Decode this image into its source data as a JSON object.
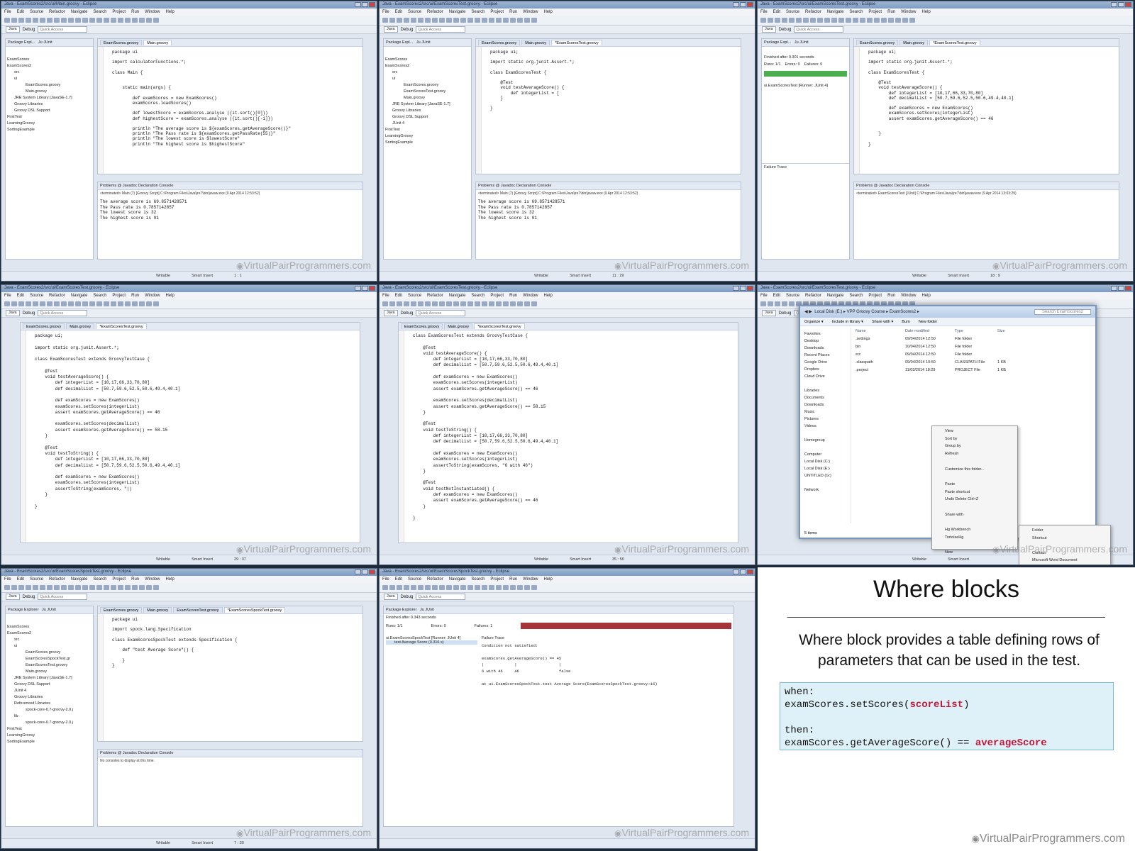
{
  "menu": [
    "File",
    "Edit",
    "Source",
    "Refactor",
    "Navigate",
    "Search",
    "Project",
    "Run",
    "Window",
    "Help"
  ],
  "perspectives": {
    "java": "Java",
    "debug": "Debug",
    "quick_access": "Quick Access"
  },
  "status": {
    "writable": "Writable",
    "insert": "Smart Insert"
  },
  "watermark": "VirtualPairProgrammers.com",
  "panels": [
    {
      "title": "Java - ExamScores2/src/ui/Main.groovy - Eclipse",
      "explorer_title": "Package Expl...",
      "explorer_title2": "Ju JUnit",
      "tree": [
        "ExamScores",
        "ExamScores2",
        "src",
        "ui",
        "ExamScores.groovy",
        "Main.groovy",
        "JRE System Library [JavaSE-1.7]",
        "Groovy Libraries",
        "Groovy DSL Support",
        "FirstTest",
        "LearningGroovy",
        "SortingExample"
      ],
      "tabs": [
        "ExamScores.groovy",
        "Main.groovy"
      ],
      "code": "package ui\n\nimport calculatorFunctions.*;\n\nclass Main {\n\n\n    static main(args) {\n\n        def examScores = new ExamScores()\n        examScores.loadScores()\n\n        def lowestScore = examScores.analyse ({it.sort()[0]})\n        def highestScore = examScores.analyse ({it.sort()[-1]})\n\n        println \"The average score is ${examScores.getAverageScore()}\"\n        println \"The Pass rate is ${examScores.getPassRate(55)}\"\n        println \"The lowest score is $lowestScore\"\n        println \"The highest score is $highestScore\"",
      "console_tabs": "Problems  @ Javadoc  Declaration  Console",
      "terminated": "<terminated> Main (7) [Groovy Script] C:\\Program Files\\Java\\jre7\\bin\\javaw.exe (9 Apr 2014 12:53:52)",
      "console": "The average score is 69.8571428571\nThe Pass rate is 0.7857142857\nThe lowest score is 32\nThe highest score is 91",
      "position": "1 : 1"
    },
    {
      "title": "Java - ExamScores2/src/ui/ExamScoresTest.groovy - Eclipse",
      "explorer_title": "Package Expl...",
      "explorer_title2": "Ju JUnit",
      "tree": [
        "ExamScores",
        "ExamScores2",
        "src",
        "ui",
        "ExamScores.groovy",
        "ExamScoresTest.groovy",
        "Main.groovy",
        "JRE System Library [JavaSE-1.7]",
        "Groovy Libraries",
        "Groovy DSL Support",
        "JUnit 4",
        "FirstTest",
        "LearningGroovy",
        "SortingExample"
      ],
      "tabs": [
        "ExamScores.groovy",
        "Main.groovy",
        "*ExamScoresTest.groovy"
      ],
      "code": "package ui;\n\nimport static org.junit.Assert.*;\n\nclass ExamScoresTest {\n\n    @Test\n    void testAverageScore() {\n        def integerList = [\n    }\n\n}",
      "console_tabs": "Problems  @ Javadoc  Declaration  Console",
      "terminated": "<terminated> Main (7) [Groovy Script] C:\\Program Files\\Java\\jre7\\bin\\javaw.exe (9 Apr 2014 12:53:52)",
      "console": "The average score is 69.8571428571\nThe Pass rate is 0.7857142857\nThe lowest score is 32\nThe highest score is 91",
      "position": "11 : 29"
    },
    {
      "title": "Java - ExamScores2/src/ui/ExamScoresTest.groovy - Eclipse",
      "explorer_title": "Package Expl...",
      "explorer_title2": "Ju JUnit",
      "finished": "Finished after 0.301 seconds",
      "runs": "Runs: 1/1",
      "errors": "Errors: 0",
      "failures": "Failures: 0",
      "junit_item": "ui.ExamScoresTest [Runner: JUnit 4]",
      "failure_trace": "Failure Trace",
      "tabs": [
        "ExamScores.groovy",
        "Main.groovy",
        "*ExamScoresTest.groovy"
      ],
      "code": "package ui;\n\nimport static org.junit.Assert.*;\n\nclass ExamScoresTest {\n\n    @Test\n    void testAverageScore() {\n        def integerList = [10,17,66,33,70,80]\n        def decimalList = [50.7,59.6,52.5,50.6,49.4,40.1]\n\n        def examScores = new ExamScores()\n        examScores.setScores(integerList)\n        assert examScores.getAverageScore() == 46\n\n\n    }\n\n}",
      "console_tabs": "Problems  @ Javadoc  Declaration  Console",
      "terminated": "<terminated> ExamScoresTest [JUnit] C:\\Program Files\\Java\\jre7\\bin\\javaw.exe (9 Apr 2014 13:03:29)",
      "console": "",
      "position": "18 : 9"
    },
    {
      "title": "Java - ExamScores2/src/ui/ExamScoresTest.groovy - Eclipse",
      "tabs": [
        "ExamScores.groovy",
        "Main.groovy",
        "*ExamScoresTest.groovy"
      ],
      "code": "package ui;\n\nimport static org.junit.Assert.*;\n\nclass ExamScoresTest extends GroovyTestCase {\n\n    @Test\n    void testAverageScore() {\n        def integerList = [10,17,66,33,70,80]\n        def decimalList = [50.7,59.6,52.5,50.6,49.4,40.1]\n\n        def examScores = new ExamScores()\n        examScores.setScores(integerList)\n        assert examScores.getAverageScore() == 46\n\n        examScores.setScores(decimalList)\n        assert examScores.getAverageScore() == 58.15\n    }\n\n    @Test\n    void testToString() {\n        def integerList = [10,17,66,33,70,80]\n        def decimalList = [50.7,59.6,52.5,50.6,49.4,40.1]\n\n        def examScores = new ExamScores()\n        examScores.setScores(integerList)\n        assertToString(examScores, \"|)\n    }\n\n}",
      "position": "29 : 37"
    },
    {
      "title": "Java - ExamScores2/src/ui/ExamScoresTest.groovy - Eclipse",
      "tabs": [
        "ExamScores.groovy",
        "Main.groovy",
        "*ExamScoresTest.groovy"
      ],
      "code": "class ExamScoresTest extends GroovyTestCase {\n\n    @Test\n    void testAverageScore() {\n        def integerList = [10,17,66,33,70,80]\n        def decimalList = [50.7,59.6,52.5,50.6,49.4,40.1]\n\n        def examScores = new ExamScores()\n        examScores.setScores(integerList)\n        assert examScores.getAverageScore() == 46\n\n        examScores.setScores(decimalList)\n        assert examScores.getAverageScore() == 58.15\n    }\n\n    @Test\n    void testToString() {\n        def integerList = [10,17,66,33,70,80]\n        def decimalList = [50.7,59.6,52.5,50.6,49.4,40.1]\n\n        def examScores = new ExamScores()\n        examScores.setScores(integerList)\n        assertToString(examScores, \"6 with 46\")\n    }\n\n    @Test\n    void testNotInstantiated() {\n        def examScores = new ExamScores()\n        assert examScores.getAverageScore() == 46\n    }\n\n}",
      "position": "35 : 50"
    },
    {
      "title": "Java - ExamScores2/src/ui/ExamScoresTest.groovy - Eclipse",
      "ex_path": "Local Disk (E:) ▸ VPP Groovy Course ▸ ExamScores2 ▸",
      "ex_search": "Search ExamScores2",
      "ex_toolbar": [
        "Organize ▾",
        "Include in library ▾",
        "Share with ▾",
        "Burn",
        "New folder"
      ],
      "ex_nav": [
        "Favorites",
        "Desktop",
        "Downloads",
        "Recent Places",
        "Google Drive",
        "Dropbox",
        "Cloud Drive",
        "",
        "Libraries",
        "Documents",
        "Downloads",
        "Music",
        "Pictures",
        "Videos",
        "",
        "Homegroup",
        "",
        "Computer",
        "Local Disk (C:)",
        "Local Disk (E:)",
        "UNTITLED (G:)",
        "",
        "Network"
      ],
      "ex_cols": [
        "Name",
        "Date modified",
        "Type",
        "Size"
      ],
      "ex_files": [
        [
          ".settings",
          "09/04/2014 12:50",
          "File folder",
          ""
        ],
        [
          "bin",
          "10/04/2014 12:50",
          "File folder",
          ""
        ],
        [
          "src",
          "09/04/2014 12:50",
          "File folder",
          ""
        ],
        [
          ".classpath",
          "09/04/2014 10:50",
          "CLASSPATH File",
          "1 KB"
        ],
        [
          ".project",
          "11/03/2014 18:29",
          "PROJECT File",
          "1 KB"
        ]
      ],
      "ex_items": "5 items",
      "ctx_menu": [
        "View",
        "Sort by",
        "Group by",
        "Refresh",
        "",
        "Customize this folder...",
        "",
        "Paste",
        "Paste shortcut",
        "Undo Delete    Ctrl+Z",
        "",
        "Share with",
        "",
        "Hg Workbench",
        "TortoiseHg",
        "",
        "New",
        "",
        "Properties"
      ],
      "sub_menu": [
        "Folder",
        "Shortcut",
        "",
        "Contact",
        "Microsoft Word Document",
        "Journal Document"
      ],
      "position": ""
    },
    {
      "title": "Java - ExamScores2/src/ui/ExamScoresSpockTest.groovy - Eclipse",
      "explorer_title": "Package Explorer",
      "explorer_title2": "Ju JUnit",
      "tree": [
        "ExamScores",
        "ExamScores2",
        "src",
        "ui",
        "ExamScores.groovy",
        "ExamScoresSpockTest.gr",
        "ExamScoresTest.groovy",
        "Main.groovy",
        "JRE System Library [JavaSE-1.7]",
        "Groovy DSL Support",
        "JUnit 4",
        "Groovy Libraries",
        "Referenced Libraries",
        "spock-core-0.7-groovy-2.0.j",
        "lib",
        "spock-core-0.7-groovy-2.0.j",
        "FirstTest",
        "LearningGroovy",
        "SortingExample"
      ],
      "tabs": [
        "ExamScores.groovy",
        "Main.groovy",
        "ExamScoresTest.groovy",
        "*ExamScoresSpockTest.groovy"
      ],
      "code": "package ui\n\nimport spock.lang.Specification\n\nclass ExamScoresSpockTest extends Specification {\n\n    def \"test Average Score\"() {\n\n    }\n}",
      "console_tabs": "Problems  @ Javadoc  Declaration  Console",
      "console": "No consoles to display at this time.",
      "position": "7 : 30"
    },
    {
      "title": "Java - ExamScores2/src/ui/ExamScoresSpockTest.groovy - Eclipse",
      "explorer_title": "Package Explorer",
      "explorer_title2": "Ju JUnit",
      "finished": "Finished after 0.343 seconds",
      "runs": "Runs: 1/1",
      "errors": "Errors: 0",
      "failures": "Failures: 1",
      "junit_item": "ui.ExamScoresSpockTest [Runner: JUnit 4]",
      "junit_sub": "test Average Score (0.316 s)",
      "failure_trace": "Failure Trace",
      "trace": [
        "Condition not satisfied:",
        "",
        "examScores.getAverageScore() == 45",
        "|             |                  |",
        "6 with 46     46                 false",
        "",
        "at ui.ExamScoresSpockTest.test Average Score(ExamScoresSpockTest.groovy:16)"
      ],
      "position": ""
    }
  ],
  "slide": {
    "title": "Where blocks",
    "description": "Where block provides a table defining rows of parameters that can be used in the test.",
    "code_when": "when:",
    "code_line1_pre": "examScores.setScores(",
    "code_line1_hl": "scoreList",
    "code_line1_post": ")",
    "code_then": "then:",
    "code_line2_pre": "examScores.getAverageScore() == ",
    "code_line2_hl": "averageScore",
    "watermark": "VirtualPairProgrammers.com"
  }
}
